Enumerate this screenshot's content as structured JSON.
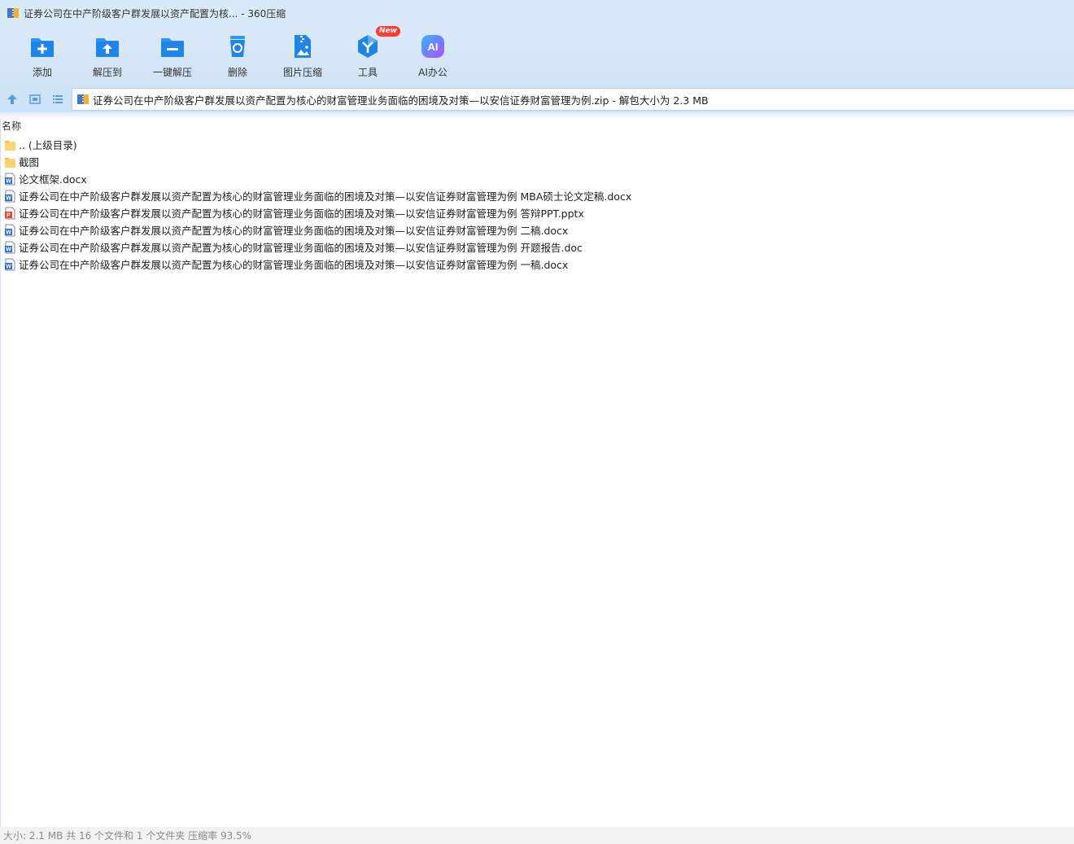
{
  "window": {
    "title": "证券公司在中产阶级客户群发展以资产配置为核... - 360压缩"
  },
  "toolbar": {
    "items": [
      {
        "label": "添加",
        "icon": "add-icon"
      },
      {
        "label": "解压到",
        "icon": "extract-to-icon"
      },
      {
        "label": "一键解压",
        "icon": "one-click-extract-icon"
      },
      {
        "label": "删除",
        "icon": "delete-icon"
      },
      {
        "label": "图片压缩",
        "icon": "image-compress-icon"
      },
      {
        "label": "工具",
        "icon": "tools-icon",
        "badge": "New"
      },
      {
        "label": "AI办公",
        "icon": "ai-office-icon"
      }
    ]
  },
  "addressbar": {
    "path": "证券公司在中产阶级客户群发展以资产配置为核心的财富管理业务面临的困境及对策—以安信证券财富管理为例.zip - 解包大小为 2.3 MB"
  },
  "filelist": {
    "column_name": "名称",
    "items": [
      {
        "name": ".. (上级目录)",
        "type": "folder"
      },
      {
        "name": "截图",
        "type": "folder"
      },
      {
        "name": "论文框架.docx",
        "type": "word"
      },
      {
        "name": "证券公司在中产阶级客户群发展以资产配置为核心的财富管理业务面临的困境及对策—以安信证券财富管理为例 MBA硕士论文定稿.docx",
        "type": "word"
      },
      {
        "name": "证券公司在中产阶级客户群发展以资产配置为核心的财富管理业务面临的困境及对策—以安信证券财富管理为例 答辩PPT.pptx",
        "type": "ppt"
      },
      {
        "name": "证券公司在中产阶级客户群发展以资产配置为核心的财富管理业务面临的困境及对策—以安信证券财富管理为例 二稿.docx",
        "type": "word"
      },
      {
        "name": "证券公司在中产阶级客户群发展以资产配置为核心的财富管理业务面临的困境及对策—以安信证券财富管理为例 开题报告.doc",
        "type": "word"
      },
      {
        "name": "证券公司在中产阶级客户群发展以资产配置为核心的财富管理业务面临的困境及对策—以安信证券财富管理为例 一稿.docx",
        "type": "word"
      }
    ]
  },
  "statusbar": {
    "text": "大小: 2.1 MB 共 16 个文件和 1 个文件夹 压缩率 93.5%"
  },
  "colors": {
    "accent": "#1e8ff0",
    "chrome": "#dbeaf8",
    "folder": "#ffd36b",
    "word": "#2b6fd6",
    "ppt": "#e0463a"
  }
}
